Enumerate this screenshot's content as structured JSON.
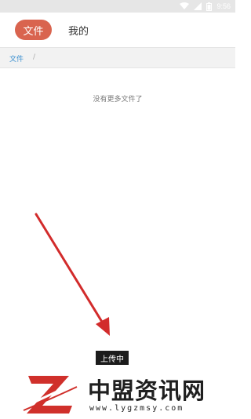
{
  "status_bar": {
    "time": "9:56",
    "icons": [
      "wifi-icon",
      "signal-icon",
      "battery-icon"
    ]
  },
  "tabs": [
    {
      "label": "文件",
      "active": true
    },
    {
      "label": "我的",
      "active": false
    }
  ],
  "breadcrumb": {
    "root": "文件",
    "separator": "/"
  },
  "empty_message": "没有更多文件了",
  "toast": "上传中",
  "watermark": {
    "title": "中盟资讯网",
    "url": "www.lygzmsy.com"
  },
  "colors": {
    "accent": "#d9644f",
    "link": "#3a8fd0",
    "arrow": "#d22b2b",
    "toast_bg": "#1c1c1c"
  }
}
